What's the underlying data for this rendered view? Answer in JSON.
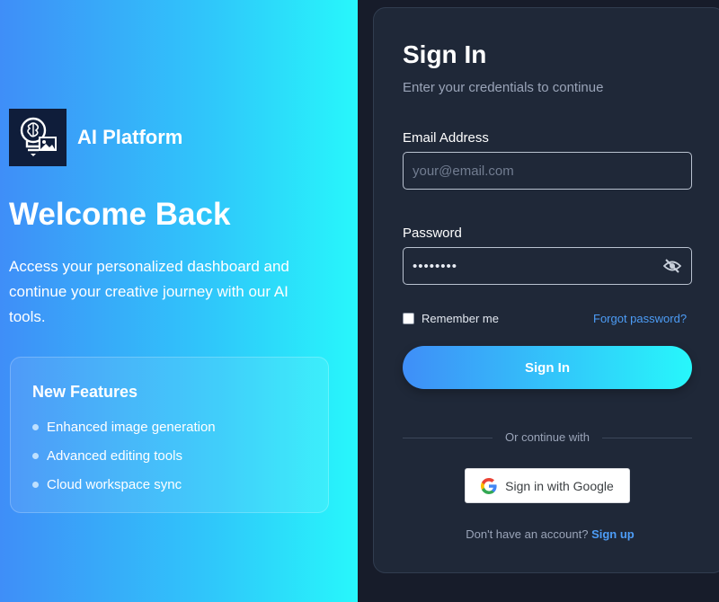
{
  "brand": {
    "name": "AI Platform",
    "logo_icon": "lightbulb-brain-icon"
  },
  "hero": {
    "title": "Welcome Back",
    "tagline": "Access your personalized dashboard and continue your creative journey with our AI tools."
  },
  "features": {
    "title": "New Features",
    "items": [
      {
        "label": "Enhanced image generation"
      },
      {
        "label": "Advanced editing tools"
      },
      {
        "label": "Cloud workspace sync"
      }
    ]
  },
  "form": {
    "title": "Sign In",
    "subtitle": "Enter your credentials to continue",
    "email_label": "Email Address",
    "email_placeholder": "your@email.com",
    "password_label": "Password",
    "password_value": "••••••••",
    "remember_label": "Remember me",
    "forgot_label": "Forgot password?",
    "submit_label": "Sign In",
    "divider_label": "Or continue with",
    "google_label": "Sign in with Google",
    "signup_text": "Don't have an account?",
    "signup_link": "Sign up"
  },
  "colors": {
    "gradient_start": "#3f8ef8",
    "gradient_end": "#27f7fb",
    "card_bg": "#1f2838",
    "page_bg": "#171c2a",
    "link": "#4d9df7"
  }
}
